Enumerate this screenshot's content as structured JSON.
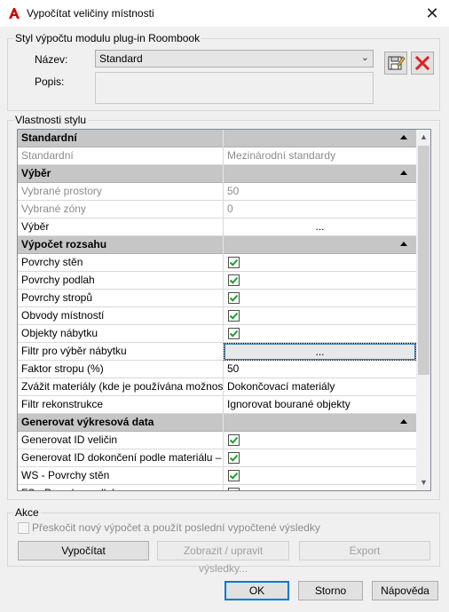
{
  "window": {
    "title": "Vypočítat veličiny místnosti",
    "close_glyph": "✕"
  },
  "style_group": {
    "legend": "Styl výpočtu modulu plug-in Roombook",
    "name_label": "Název:",
    "name_value": "Standard",
    "desc_label": "Popis:",
    "desc_value": ""
  },
  "props_group": {
    "legend": "Vlastnosti stylu"
  },
  "grid": {
    "rows": [
      {
        "type": "cat",
        "label": "Standardní"
      },
      {
        "type": "prop",
        "label": "Standardní",
        "value": "Mezinárodní standardy",
        "disabled": true
      },
      {
        "type": "cat",
        "label": "Výběr"
      },
      {
        "type": "prop",
        "label": "Vybrané prostory",
        "value": "50",
        "disabled": true
      },
      {
        "type": "prop",
        "label": "Vybrané zóny",
        "value": "0",
        "disabled": true
      },
      {
        "type": "prop",
        "label": "Výběr",
        "value": "...",
        "ellipsis": true
      },
      {
        "type": "cat",
        "label": "Výpočet rozsahu"
      },
      {
        "type": "check",
        "label": "Povrchy stěn",
        "checked": true
      },
      {
        "type": "check",
        "label": "Povrchy podlah",
        "checked": true
      },
      {
        "type": "check",
        "label": "Povrchy stropů",
        "checked": true
      },
      {
        "type": "check",
        "label": "Obvody místností",
        "checked": true
      },
      {
        "type": "check",
        "label": "Objekty nábytku",
        "checked": true
      },
      {
        "type": "prop",
        "label": "Filtr pro výběr nábytku",
        "value": "...",
        "ellipsis": true,
        "selected": true
      },
      {
        "type": "prop",
        "label": "Faktor stropu (%)",
        "value": "50"
      },
      {
        "type": "prop",
        "label": "Zvážit materiály (kde je používána možnost",
        "value": "Dokončovací materiály"
      },
      {
        "type": "prop",
        "label": "Filtr rekonstrukce",
        "value": "Ignorovat bourané objekty"
      },
      {
        "type": "cat",
        "label": "Generovat výkresová data"
      },
      {
        "type": "check",
        "label": "Generovat ID veličin",
        "checked": true
      },
      {
        "type": "check",
        "label": "Generovat ID dokončení podle materiálu –",
        "checked": true
      },
      {
        "type": "check",
        "label": "WS - Povrchy stěn",
        "checked": true
      },
      {
        "type": "check",
        "label": "FS - Povrchy podlah",
        "checked": true
      }
    ]
  },
  "actions_group": {
    "legend": "Akce",
    "skip_label": "Přeskočit nový výpočet a použít poslední vypočtené výsledky",
    "calculate": "Vypočítat",
    "show_edit": "Zobrazit / upravit výsledky...",
    "export": "Export"
  },
  "footer": {
    "ok": "OK",
    "cancel": "Storno",
    "help": "Nápověda"
  },
  "icons": {
    "app": "autocad-logo-icon",
    "save": "save-style-icon",
    "delete": "delete-style-icon",
    "check_color": "#1e9e2a",
    "delete_color": "#e02020",
    "brand_color": "#d40000"
  }
}
